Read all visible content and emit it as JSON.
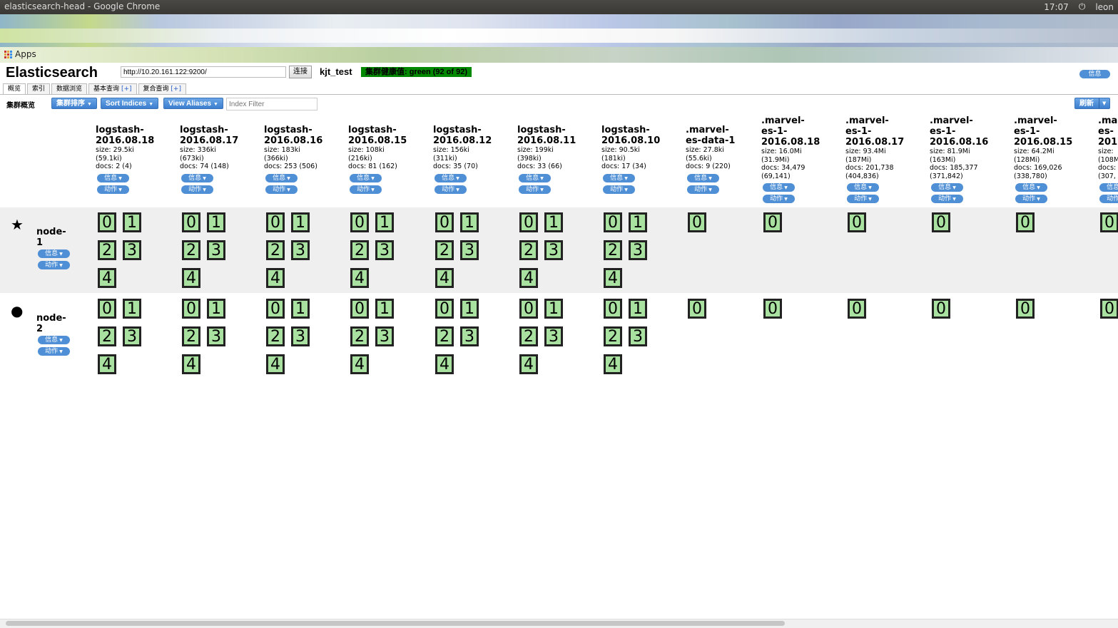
{
  "os_bar": {
    "window_title": "elasticsearch-head - Google Chrome",
    "clock": "17:07",
    "user": "leon"
  },
  "bookmarks": {
    "apps_label": "Apps"
  },
  "header": {
    "brand": "Elasticsearch",
    "url_value": "http://10.20.161.122:9200/",
    "connect_label": "连接",
    "cluster_name": "kjt_test",
    "health_text": "集群健康值: green (92 of 92)",
    "info_label": "信息"
  },
  "tabs": [
    {
      "label": "概览",
      "plus": ""
    },
    {
      "label": "索引",
      "plus": ""
    },
    {
      "label": "数据浏览",
      "plus": ""
    },
    {
      "label": "基本查询",
      "plus": "[+]"
    },
    {
      "label": "复合查询",
      "plus": "[+]"
    }
  ],
  "toolbar": {
    "title": "集群概览",
    "sort_cluster_label": "集群排序",
    "sort_indices_label": "Sort Indices",
    "view_aliases_label": "View Aliases",
    "filter_placeholder": "Index Filter",
    "refresh_label": "刷新"
  },
  "pill_labels": {
    "info": "信息",
    "action": "动作"
  },
  "colors": {
    "shard_fill": "#a9e1a0",
    "pill_blue": "#4f8fd6",
    "health_green": "#008800"
  },
  "indices": [
    {
      "name": [
        "logstash-",
        "2016.08.18"
      ],
      "meta": [
        "size: 29.5ki",
        "(59.1ki)",
        "docs: 2 (4)"
      ],
      "shards": 5
    },
    {
      "name": [
        "logstash-",
        "2016.08.17"
      ],
      "meta": [
        "size: 336ki",
        "(673ki)",
        "docs: 74 (148)"
      ],
      "shards": 5
    },
    {
      "name": [
        "logstash-",
        "2016.08.16"
      ],
      "meta": [
        "size: 183ki",
        "(366ki)",
        "docs: 253 (506)"
      ],
      "shards": 5
    },
    {
      "name": [
        "logstash-",
        "2016.08.15"
      ],
      "meta": [
        "size: 108ki",
        "(216ki)",
        "docs: 81 (162)"
      ],
      "shards": 5
    },
    {
      "name": [
        "logstash-",
        "2016.08.12"
      ],
      "meta": [
        "size: 156ki",
        "(311ki)",
        "docs: 35 (70)"
      ],
      "shards": 5
    },
    {
      "name": [
        "logstash-",
        "2016.08.11"
      ],
      "meta": [
        "size: 199ki",
        "(398ki)",
        "docs: 33 (66)"
      ],
      "shards": 5
    },
    {
      "name": [
        "logstash-",
        "2016.08.10"
      ],
      "meta": [
        "size: 90.5ki",
        "(181ki)",
        "docs: 17 (34)"
      ],
      "shards": 5
    },
    {
      "name": [
        ".marvel-",
        "es-data-1"
      ],
      "meta": [
        "size: 27.8ki",
        "(55.6ki)",
        "docs: 9 (220)"
      ],
      "shards": 1
    },
    {
      "name": [
        ".marvel-",
        "es-1-",
        "2016.08.18"
      ],
      "meta": [
        "size: 16.0Mi",
        "(31.9Mi)",
        "docs: 34,479",
        "(69,141)"
      ],
      "shards": 1
    },
    {
      "name": [
        ".marvel-",
        "es-1-",
        "2016.08.17"
      ],
      "meta": [
        "size: 93.4Mi",
        "(187Mi)",
        "docs: 201,738",
        "(404,836)"
      ],
      "shards": 1
    },
    {
      "name": [
        ".marvel-",
        "es-1-",
        "2016.08.16"
      ],
      "meta": [
        "size: 81.9Mi",
        "(163Mi)",
        "docs: 185,377",
        "(371,842)"
      ],
      "shards": 1
    },
    {
      "name": [
        ".marvel-",
        "es-1-",
        "2016.08.15"
      ],
      "meta": [
        "size: 64.2Mi",
        "(128Mi)",
        "docs: 169,026",
        "(338,780)"
      ],
      "shards": 1
    },
    {
      "name": [
        ".ma",
        "es-",
        "201"
      ],
      "meta": [
        "size:",
        "(108M",
        "docs:",
        "(307,"
      ],
      "shards": 1
    }
  ],
  "nodes": [
    {
      "symbol": "★",
      "name": [
        "node-",
        "1"
      ],
      "symbol_icon": "star-icon"
    },
    {
      "symbol": "●",
      "name": [
        "node-",
        "2"
      ],
      "symbol_icon": "circle-icon"
    }
  ]
}
